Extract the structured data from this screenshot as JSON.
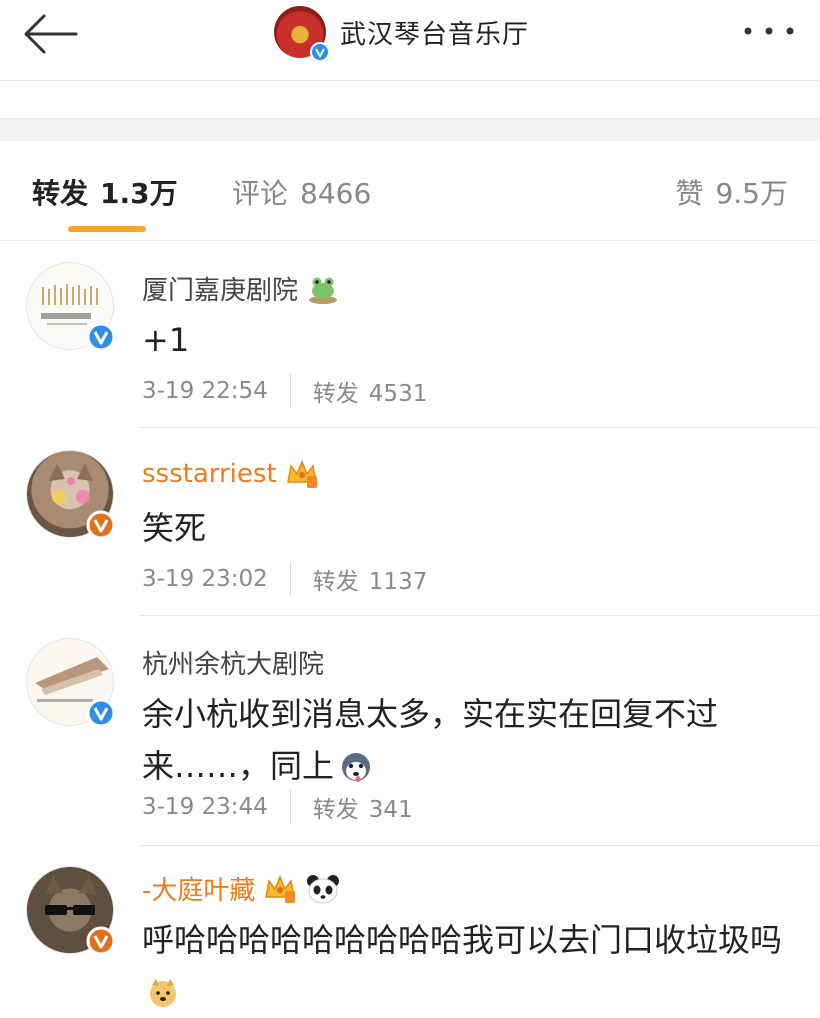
{
  "header": {
    "title": "武汉琴台音乐厅"
  },
  "tabs": {
    "repost_label": "转发",
    "repost_count": "1.3万",
    "comments_label": "评论",
    "comments_count": "8466",
    "likes_label": "赞",
    "likes_count": "9.5万"
  },
  "posts": [
    {
      "username": "厦门嘉庚剧院",
      "content": "+1",
      "time": "3-19 22:54",
      "repost_label": "转发",
      "repost_count": "4531"
    },
    {
      "username": "ssstarriest",
      "content": "笑死",
      "time": "3-19 23:02",
      "repost_label": "转发",
      "repost_count": "1137"
    },
    {
      "username": "杭州余杭大剧院",
      "content": "余小杭收到消息太多，实在实在回复不过来……，同上",
      "time": "3-19 23:44",
      "repost_label": "转发",
      "repost_count": "341"
    },
    {
      "username": "-大庭叶藏",
      "content": "呼哈哈哈哈哈哈哈哈哈我可以去门口收垃圾吗"
    }
  ],
  "colors": {
    "accent_underline": "#f5a623",
    "vip_name": "#ef7b1b",
    "verified_blue": "#2d8fe6",
    "verified_orange": "#e0701c"
  }
}
